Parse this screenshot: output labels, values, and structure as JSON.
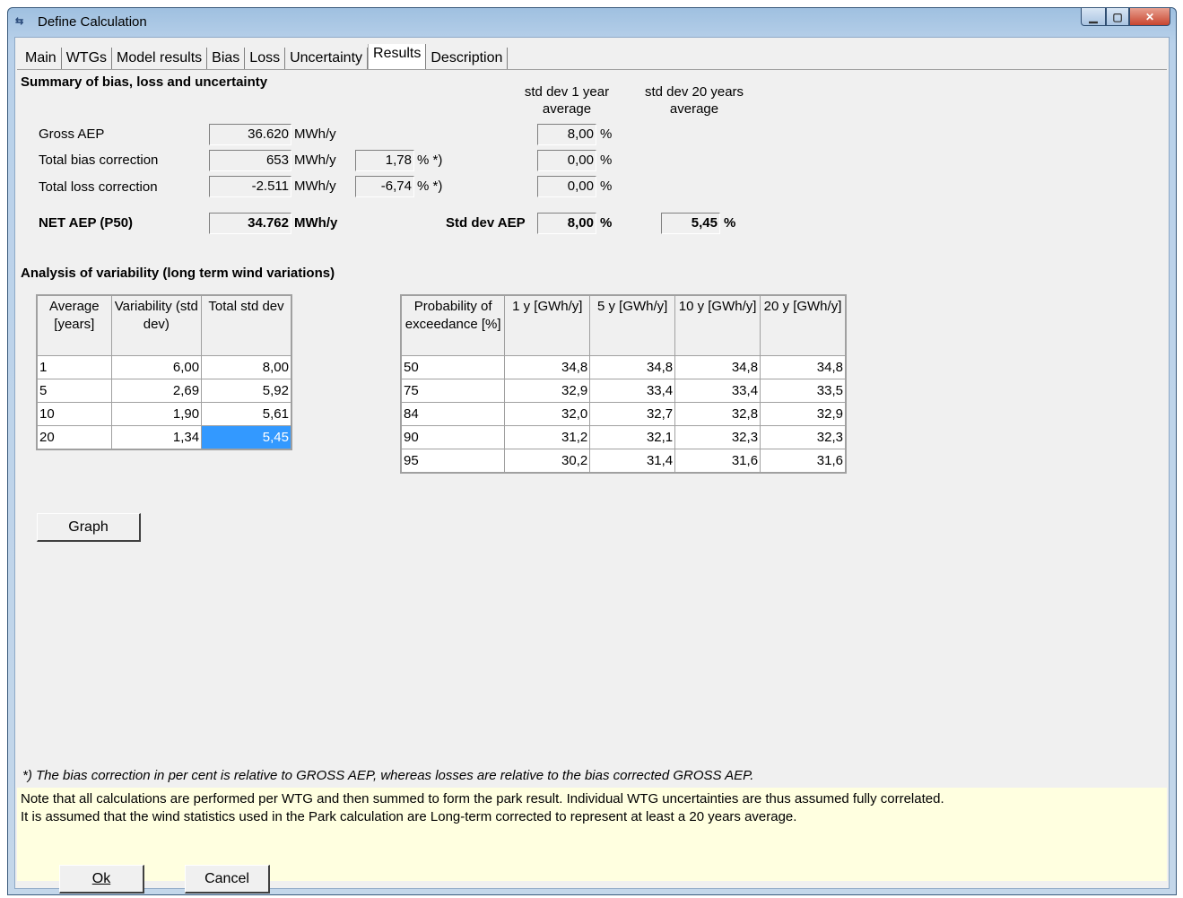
{
  "window": {
    "title": "Define Calculation",
    "icon": "app-icon"
  },
  "tabs": [
    "Main",
    "WTGs",
    "Model results",
    "Bias",
    "Loss",
    "Uncertainty",
    "Results",
    "Description"
  ],
  "active_tab": "Results",
  "summary": {
    "heading": "Summary of bias, loss and uncertainty",
    "col_std1_line1": "std dev 1 year",
    "col_std1_line2": "average",
    "col_std20_line1": "std dev 20 years",
    "col_std20_line2": "average",
    "rows": {
      "gross": {
        "label": "Gross AEP",
        "value": "36.620",
        "unit": "MWh/y",
        "std": "8,00",
        "std_unit": "%"
      },
      "bias": {
        "label": "Total bias correction",
        "value": "653",
        "unit": "MWh/y",
        "pct": "1,78",
        "pct_unit": "% *)",
        "std": "0,00",
        "std_unit": "%"
      },
      "loss": {
        "label": "Total loss correction",
        "value": "-2.511",
        "unit": "MWh/y",
        "pct": "-6,74",
        "pct_unit": "% *)",
        "std": "0,00",
        "std_unit": "%"
      },
      "net": {
        "label": "NET AEP (P50)",
        "value": "34.762",
        "unit": "MWh/y",
        "std_label": "Std dev AEP",
        "std1": "8,00",
        "std1_unit": "%",
        "std20": "5,45",
        "std20_unit": "%"
      }
    }
  },
  "variability": {
    "heading": "Analysis of variability (long term wind variations)",
    "headers": [
      "Average [years]",
      "Variability (std dev)",
      "Total std dev"
    ],
    "rows": [
      [
        "1",
        "6,00",
        "8,00"
      ],
      [
        "5",
        "2,69",
        "5,92"
      ],
      [
        "10",
        "1,90",
        "5,61"
      ],
      [
        "20",
        "1,34",
        "5,45"
      ]
    ]
  },
  "exceedance": {
    "headers": [
      "Probability of exceedance [%]",
      "1 y [GWh/y]",
      "5 y [GWh/y]",
      "10 y [GWh/y]",
      "20 y [GWh/y]"
    ],
    "rows": [
      [
        "50",
        "34,8",
        "34,8",
        "34,8",
        "34,8"
      ],
      [
        "75",
        "32,9",
        "33,4",
        "33,4",
        "33,5"
      ],
      [
        "84",
        "32,0",
        "32,7",
        "32,8",
        "32,9"
      ],
      [
        "90",
        "31,2",
        "32,1",
        "32,3",
        "32,3"
      ],
      [
        "95",
        "30,2",
        "31,4",
        "31,6",
        "31,6"
      ]
    ]
  },
  "graph_button": "Graph",
  "footnote": "*) The bias correction in per cent is relative to GROSS AEP, whereas losses are relative to the bias corrected GROSS AEP.",
  "notes": [
    "Note that all calculations are performed per WTG and then summed to form the park result. Individual WTG uncertainties are thus assumed fully correlated.",
    "It is assumed that the wind statistics used in the Park calculation are Long-term corrected to represent at least a 20 years average."
  ],
  "buttons": {
    "ok": "Ok",
    "cancel": "Cancel"
  },
  "colors": {
    "selection": "#3399ff",
    "notes_bg": "#ffffe0"
  }
}
